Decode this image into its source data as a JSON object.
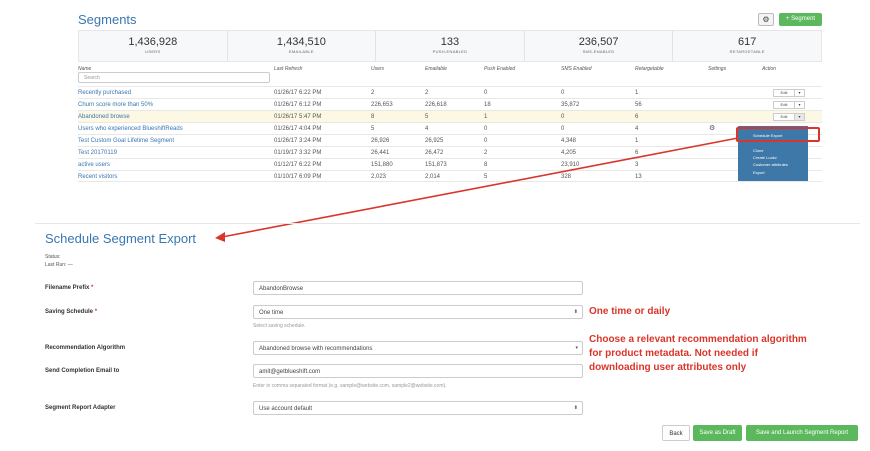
{
  "header": {
    "title": "Segments",
    "settings_icon": "gear-icon",
    "add_segment_label": "+ Segment"
  },
  "stats": [
    {
      "value": "1,436,928",
      "label": "USERS"
    },
    {
      "value": "1,434,510",
      "label": "EMAILABLE"
    },
    {
      "value": "133",
      "label": "PUSH-ENABLED"
    },
    {
      "value": "236,507",
      "label": "SMS-ENABLED"
    },
    {
      "value": "617",
      "label": "RETARGETABLE"
    }
  ],
  "table": {
    "columns": [
      "Name",
      "Last Refresh",
      "Users",
      "Emailable",
      "Push Enabled",
      "SMS Enabled",
      "Retargetable",
      "Settings",
      "Action"
    ],
    "search_placeholder": "Search",
    "edit_label": "Edit",
    "rows": [
      {
        "name": "Recently purchased",
        "refresh": "01/26/17 6:22 PM",
        "users": "2",
        "emailable": "2",
        "push": "0",
        "sms": "0",
        "retarget": "1"
      },
      {
        "name": "Churn score more than 50%",
        "refresh": "01/26/17 6:12 PM",
        "users": "226,653",
        "emailable": "226,618",
        "push": "18",
        "sms": "35,872",
        "retarget": "56"
      },
      {
        "name": "Abandoned browse",
        "refresh": "01/26/17 5:47 PM",
        "users": "8",
        "emailable": "5",
        "push": "1",
        "sms": "0",
        "retarget": "6"
      },
      {
        "name": "Users who experienced BlueshiftReads",
        "refresh": "01/26/17 4:04 PM",
        "users": "5",
        "emailable": "4",
        "push": "0",
        "sms": "0",
        "retarget": "4"
      },
      {
        "name": "Test Custom Goal Lifetime Segment",
        "refresh": "01/26/17 3:24 PM",
        "users": "26,926",
        "emailable": "26,925",
        "push": "0",
        "sms": "4,348",
        "retarget": "1"
      },
      {
        "name": "Test 20170119",
        "refresh": "01/19/17 3:32 PM",
        "users": "26,441",
        "emailable": "26,472",
        "push": "2",
        "sms": "4,205",
        "retarget": "6"
      },
      {
        "name": "active users",
        "refresh": "01/12/17 6:22 PM",
        "users": "151,880",
        "emailable": "151,873",
        "push": "8",
        "sms": "23,910",
        "retarget": "3"
      },
      {
        "name": "Recent visitors",
        "refresh": "01/10/17 6:09 PM",
        "users": "2,023",
        "emailable": "2,014",
        "push": "5",
        "sms": "328",
        "retarget": "13"
      }
    ]
  },
  "dropdown_menu": {
    "items": [
      "Schedule Export",
      "Clone",
      "Create Lookv",
      "Customer attributes",
      "Export"
    ]
  },
  "form": {
    "title": "Schedule Segment Export",
    "status_label": "Status:",
    "last_run_label": "Last Run: —",
    "filename_label": "Filename Prefix",
    "filename_value": "AbandonBrowse",
    "schedule_label": "Saving Schedule",
    "schedule_value": "One time",
    "schedule_help": "Select saving schedule.",
    "algo_label": "Recommendation Algorithm",
    "algo_value": "Abandoned browse with recommendations",
    "email_label": "Send Completion Email to",
    "email_value": "amit@getblueshift.com",
    "email_help": "Enter in comma separated format (e.g. sample@website.com, sample2@website.com).",
    "adapter_label": "Segment Report Adapter",
    "adapter_value": "Use account default",
    "required_mark": "*"
  },
  "annotations": {
    "schedule_note": "One time or daily",
    "algo_note_1": "Choose a relevant recommendation algorithm",
    "algo_note_2": "for product metadata.  Not needed if",
    "algo_note_3": "downloading user attributes only"
  },
  "buttons": {
    "back": "Back",
    "save_draft": "Save as Draft",
    "launch": "Save and Launch Segment Report"
  },
  "colors": {
    "accent_blue": "#3a77b0",
    "green": "#5cb85c",
    "annotation_red": "#d9352a",
    "menu_blue": "#3d78a8"
  }
}
